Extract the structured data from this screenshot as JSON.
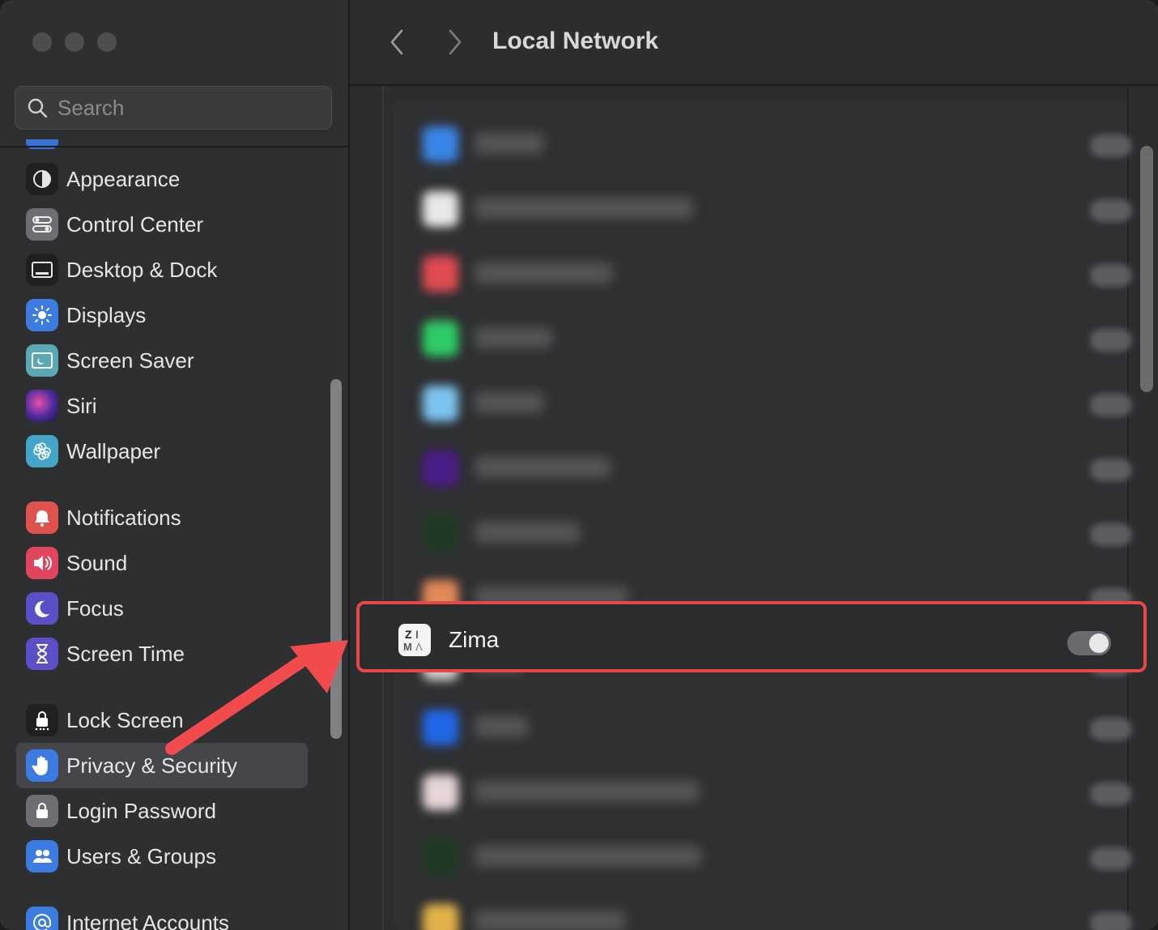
{
  "window": {
    "title": "Local Network"
  },
  "search": {
    "placeholder": "Search"
  },
  "sidebar": {
    "items": [
      {
        "label": "Appearance",
        "color": "#1f2022"
      },
      {
        "label": "Control Center",
        "color": "#6e6f72"
      },
      {
        "label": "Desktop & Dock",
        "color": "#1f2022"
      },
      {
        "label": "Displays",
        "color": "#3c7be0"
      },
      {
        "label": "Screen Saver",
        "color": "#5aa7b5"
      },
      {
        "label": "Siri",
        "color": "#7a3fb0"
      },
      {
        "label": "Wallpaper",
        "color": "#43a6c9"
      },
      {
        "label": "Notifications",
        "color": "#e0524e"
      },
      {
        "label": "Sound",
        "color": "#e0455d"
      },
      {
        "label": "Focus",
        "color": "#5b4fc8"
      },
      {
        "label": "Screen Time",
        "color": "#5b4fc8"
      },
      {
        "label": "Lock Screen",
        "color": "#1f2022"
      },
      {
        "label": "Privacy & Security",
        "color": "#3c7be0",
        "selected": true
      },
      {
        "label": "Login Password",
        "color": "#6e6f72"
      },
      {
        "label": "Users & Groups",
        "color": "#3c7be0"
      },
      {
        "label": "Internet Accounts",
        "color": "#3c7be0"
      }
    ]
  },
  "apps": {
    "highlighted": {
      "name": "Zima",
      "enabled": false
    },
    "blurred_row_colors": [
      "#3a86e8",
      "#e8e8e8",
      "#e04a52",
      "#2ecb66",
      "#7cc4f0",
      "#4a1c8a",
      "#1f3a22",
      "#e28a5a",
      "#cfcfcf",
      "#2067e8",
      "#e6d6d6",
      "#1f3a22",
      "#e2b24a"
    ]
  },
  "accent": {
    "highlight_border": "#e8474a",
    "arrow": "#f24b4e"
  }
}
